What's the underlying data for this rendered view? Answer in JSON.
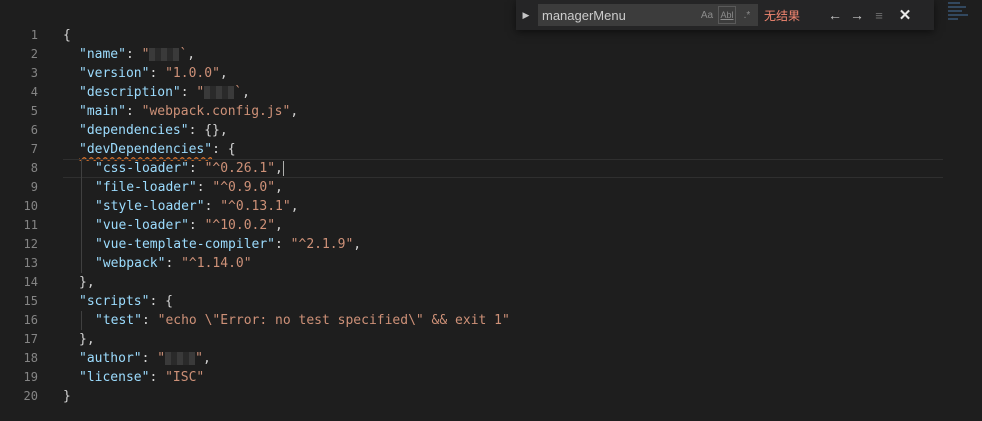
{
  "editor": {
    "line_numbers": [
      "1",
      "2",
      "3",
      "4",
      "5",
      "6",
      "7",
      "8",
      "9",
      "10",
      "11",
      "12",
      "13",
      "14",
      "15",
      "16",
      "17",
      "18",
      "19",
      "20"
    ],
    "lines": [
      {
        "indent": 0,
        "segments": [
          {
            "t": "p",
            "v": "{"
          }
        ]
      },
      {
        "indent": 1,
        "segments": [
          {
            "t": "k",
            "v": "\"name\""
          },
          {
            "t": "p",
            "v": ": "
          },
          {
            "t": "s",
            "v": "\""
          },
          {
            "t": "redact"
          },
          {
            "t": "s",
            "v": "`"
          },
          {
            "t": "p",
            "v": ","
          }
        ]
      },
      {
        "indent": 1,
        "segments": [
          {
            "t": "k",
            "v": "\"version\""
          },
          {
            "t": "p",
            "v": ": "
          },
          {
            "t": "s",
            "v": "\"1.0.0\""
          },
          {
            "t": "p",
            "v": ","
          }
        ]
      },
      {
        "indent": 1,
        "segments": [
          {
            "t": "k",
            "v": "\"description\""
          },
          {
            "t": "p",
            "v": ": "
          },
          {
            "t": "s",
            "v": "\""
          },
          {
            "t": "redact"
          },
          {
            "t": "s",
            "v": "`"
          },
          {
            "t": "p",
            "v": ","
          }
        ]
      },
      {
        "indent": 1,
        "segments": [
          {
            "t": "k",
            "v": "\"main\""
          },
          {
            "t": "p",
            "v": ": "
          },
          {
            "t": "s",
            "v": "\"webpack.config.js\""
          },
          {
            "t": "p",
            "v": ","
          }
        ]
      },
      {
        "indent": 1,
        "segments": [
          {
            "t": "k",
            "v": "\"dependencies\""
          },
          {
            "t": "p",
            "v": ": {},"
          }
        ]
      },
      {
        "indent": 1,
        "segments": [
          {
            "t": "k squiggle",
            "v": "\"devDependencies\""
          },
          {
            "t": "p",
            "v": ": {"
          }
        ]
      },
      {
        "indent": 2,
        "current": true,
        "segments": [
          {
            "t": "k",
            "v": "\"css-loader\""
          },
          {
            "t": "p",
            "v": ": "
          },
          {
            "t": "s",
            "v": "\"^0.26.1\""
          },
          {
            "t": "p",
            "v": ","
          },
          {
            "t": "cursor"
          }
        ]
      },
      {
        "indent": 2,
        "segments": [
          {
            "t": "k",
            "v": "\"file-loader\""
          },
          {
            "t": "p",
            "v": ": "
          },
          {
            "t": "s",
            "v": "\"^0.9.0\""
          },
          {
            "t": "p",
            "v": ","
          }
        ]
      },
      {
        "indent": 2,
        "segments": [
          {
            "t": "k",
            "v": "\"style-loader\""
          },
          {
            "t": "p",
            "v": ": "
          },
          {
            "t": "s",
            "v": "\"^0.13.1\""
          },
          {
            "t": "p",
            "v": ","
          }
        ]
      },
      {
        "indent": 2,
        "segments": [
          {
            "t": "k",
            "v": "\"vue-loader\""
          },
          {
            "t": "p",
            "v": ": "
          },
          {
            "t": "s",
            "v": "\"^10.0.2\""
          },
          {
            "t": "p",
            "v": ","
          }
        ]
      },
      {
        "indent": 2,
        "segments": [
          {
            "t": "k",
            "v": "\"vue-template-compiler\""
          },
          {
            "t": "p",
            "v": ": "
          },
          {
            "t": "s",
            "v": "\"^2.1.9\""
          },
          {
            "t": "p",
            "v": ","
          }
        ]
      },
      {
        "indent": 2,
        "segments": [
          {
            "t": "k",
            "v": "\"webpack\""
          },
          {
            "t": "p",
            "v": ": "
          },
          {
            "t": "s",
            "v": "\"^1.14.0\""
          }
        ]
      },
      {
        "indent": 1,
        "segments": [
          {
            "t": "p",
            "v": "},"
          }
        ]
      },
      {
        "indent": 1,
        "segments": [
          {
            "t": "k",
            "v": "\"scripts\""
          },
          {
            "t": "p",
            "v": ": {"
          }
        ]
      },
      {
        "indent": 2,
        "segments": [
          {
            "t": "k",
            "v": "\"test\""
          },
          {
            "t": "p",
            "v": ": "
          },
          {
            "t": "s",
            "v": "\"echo \\\"Error: no test specified\\\" && exit 1\""
          }
        ]
      },
      {
        "indent": 1,
        "segments": [
          {
            "t": "p",
            "v": "},"
          }
        ]
      },
      {
        "indent": 1,
        "segments": [
          {
            "t": "k",
            "v": "\"author\""
          },
          {
            "t": "p",
            "v": ": "
          },
          {
            "t": "s",
            "v": "\""
          },
          {
            "t": "redact"
          },
          {
            "t": "s",
            "v": "\""
          },
          {
            "t": "p",
            "v": ","
          }
        ]
      },
      {
        "indent": 1,
        "segments": [
          {
            "t": "k",
            "v": "\"license\""
          },
          {
            "t": "p",
            "v": ": "
          },
          {
            "t": "s",
            "v": "\"ISC\""
          }
        ]
      },
      {
        "indent": 0,
        "segments": [
          {
            "t": "p",
            "v": "}"
          }
        ]
      }
    ]
  },
  "find_widget": {
    "toggle_replace_icon": "chevron-right-icon",
    "search_value": "managerMenu",
    "match_case_label": "Aa",
    "whole_word_label": "Abl",
    "regex_label": ".*",
    "result_text": "无结果",
    "prev_icon": "arrow-left-icon",
    "next_icon": "arrow-right-icon",
    "find_in_selection_icon": "list-icon",
    "close_icon": "close-icon"
  },
  "colors": {
    "background": "#1e1e1e",
    "key": "#9cdcfe",
    "string": "#ce9178",
    "no_result": "#f48771"
  }
}
